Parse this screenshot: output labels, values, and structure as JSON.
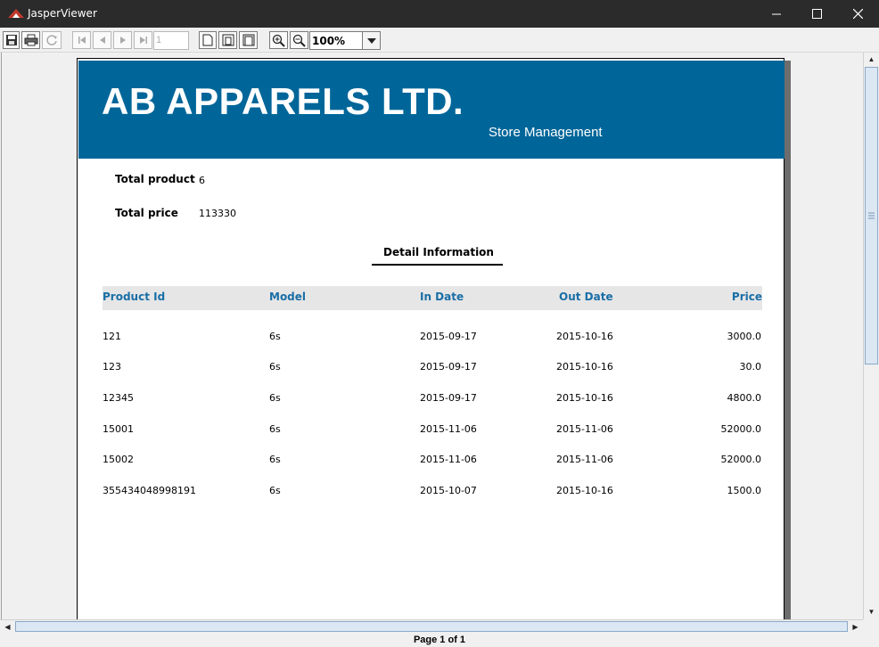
{
  "window": {
    "title": "JasperViewer",
    "controls": [
      "minimize",
      "maximize",
      "close"
    ]
  },
  "toolbar": {
    "page_number": "1",
    "zoom": "100%",
    "buttons": [
      "save-icon",
      "print-icon",
      "reload-icon",
      "first-page-icon",
      "previous-page-icon",
      "next-page-icon",
      "last-page-icon",
      "actual-size-icon",
      "fit-page-icon",
      "fit-width-icon",
      "zoom-in-icon",
      "zoom-out-icon"
    ]
  },
  "report": {
    "company": "AB APPARELS LTD.",
    "subtitle": "Store Management",
    "banner_color": "#006699",
    "summary": {
      "total_product_label": "Total product",
      "total_product_value": "6",
      "total_price_label": "Total price",
      "total_price_value": "113330"
    },
    "section_title": "Detail Information",
    "columns": [
      "Product Id",
      "Model",
      "In Date",
      "Out Date",
      "Price"
    ],
    "header_color": "#1a6ea6",
    "rows": [
      {
        "id": "121",
        "model": "6s",
        "in": "2015-09-17",
        "out": "2015-10-16",
        "price": "3000.0"
      },
      {
        "id": "123",
        "model": "6s",
        "in": "2015-09-17",
        "out": "2015-10-16",
        "price": "30.0"
      },
      {
        "id": "12345",
        "model": "6s",
        "in": "2015-09-17",
        "out": "2015-10-16",
        "price": "4800.0"
      },
      {
        "id": "15001",
        "model": "6s",
        "in": "2015-11-06",
        "out": "2015-11-06",
        "price": "52000.0"
      },
      {
        "id": "15002",
        "model": "6s",
        "in": "2015-11-06",
        "out": "2015-11-06",
        "price": "52000.0"
      },
      {
        "id": "355434048998191",
        "model": "6s",
        "in": "2015-10-07",
        "out": "2015-10-16",
        "price": "1500.0"
      }
    ]
  },
  "status": {
    "page_indicator": "Page 1 of 1"
  }
}
